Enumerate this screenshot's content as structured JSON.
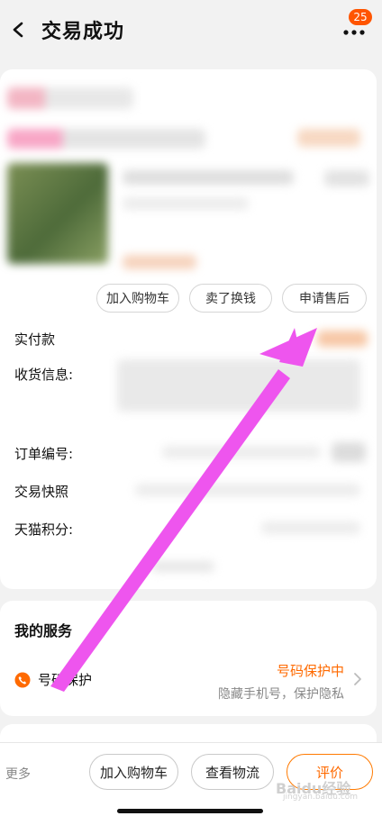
{
  "header": {
    "title": "交易成功",
    "badge_count": "25"
  },
  "order_card": {
    "actions": [
      "加入购物车",
      "卖了换钱",
      "申请售后"
    ],
    "rows": {
      "paid_label": "实付款",
      "shipping_label": "收货信息:",
      "order_no_label": "订单编号:",
      "snapshot_label": "交易快照",
      "points_label": "天猫积分:"
    }
  },
  "services": {
    "title": "我的服务",
    "item_name": "号码保护",
    "item_status": "号码保护中",
    "item_desc": "隐藏手机号，保护隐私"
  },
  "bottom_bar": {
    "more_label": "更多",
    "add_cart_label": "加入购物车",
    "logistics_label": "查看物流",
    "review_label": "评价"
  },
  "watermark": {
    "text": "Baidu经验",
    "sub": "jingyan.baidu.com"
  },
  "colors": {
    "accent": "#ff6a00",
    "arrow": "#ee55ee",
    "badge": "#ff5500"
  }
}
